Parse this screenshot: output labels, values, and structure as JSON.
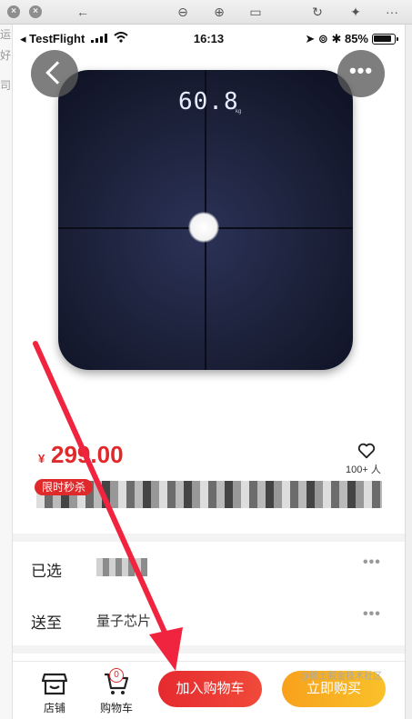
{
  "window": {
    "close_glyph": "×",
    "minimize_glyph": "×",
    "back_glyph": "←",
    "zoom_out_glyph": "⊖",
    "zoom_in_glyph": "⊕",
    "fit_glyph": "▭",
    "rotate_glyph": "↻",
    "wand_glyph": "✦",
    "more_glyph": "···",
    "left_edge_chars": [
      "运",
      "好",
      "司"
    ]
  },
  "status_bar": {
    "carrier": "◂ TestFlight",
    "time": "16:13",
    "battery_text": "85%",
    "signal_icon": "signal-bars-icon",
    "wifi_icon": "wifi-icon"
  },
  "product": {
    "scale_readout": "60.8",
    "scale_unit": "kg",
    "price_currency": "¥",
    "price": "299.00",
    "favorite_count": "100+ 人",
    "flash_badge": "限时秒杀"
  },
  "options": [
    {
      "label": "已选",
      "value": "",
      "more": "•••"
    },
    {
      "label": "送至",
      "value": "量子芯片",
      "more": "•••"
    }
  ],
  "bottom_bar": {
    "store_label": "店铺",
    "cart_label": "购物车",
    "cart_count": "0",
    "add_to_cart": "加入购物车",
    "buy_now": "立即购买"
  },
  "watermark": "@稀土掘金技术社区",
  "colors": {
    "accent_red": "#e0292b",
    "buy_orange": "#f9b222",
    "annotation_arrow": "#f0243f"
  }
}
